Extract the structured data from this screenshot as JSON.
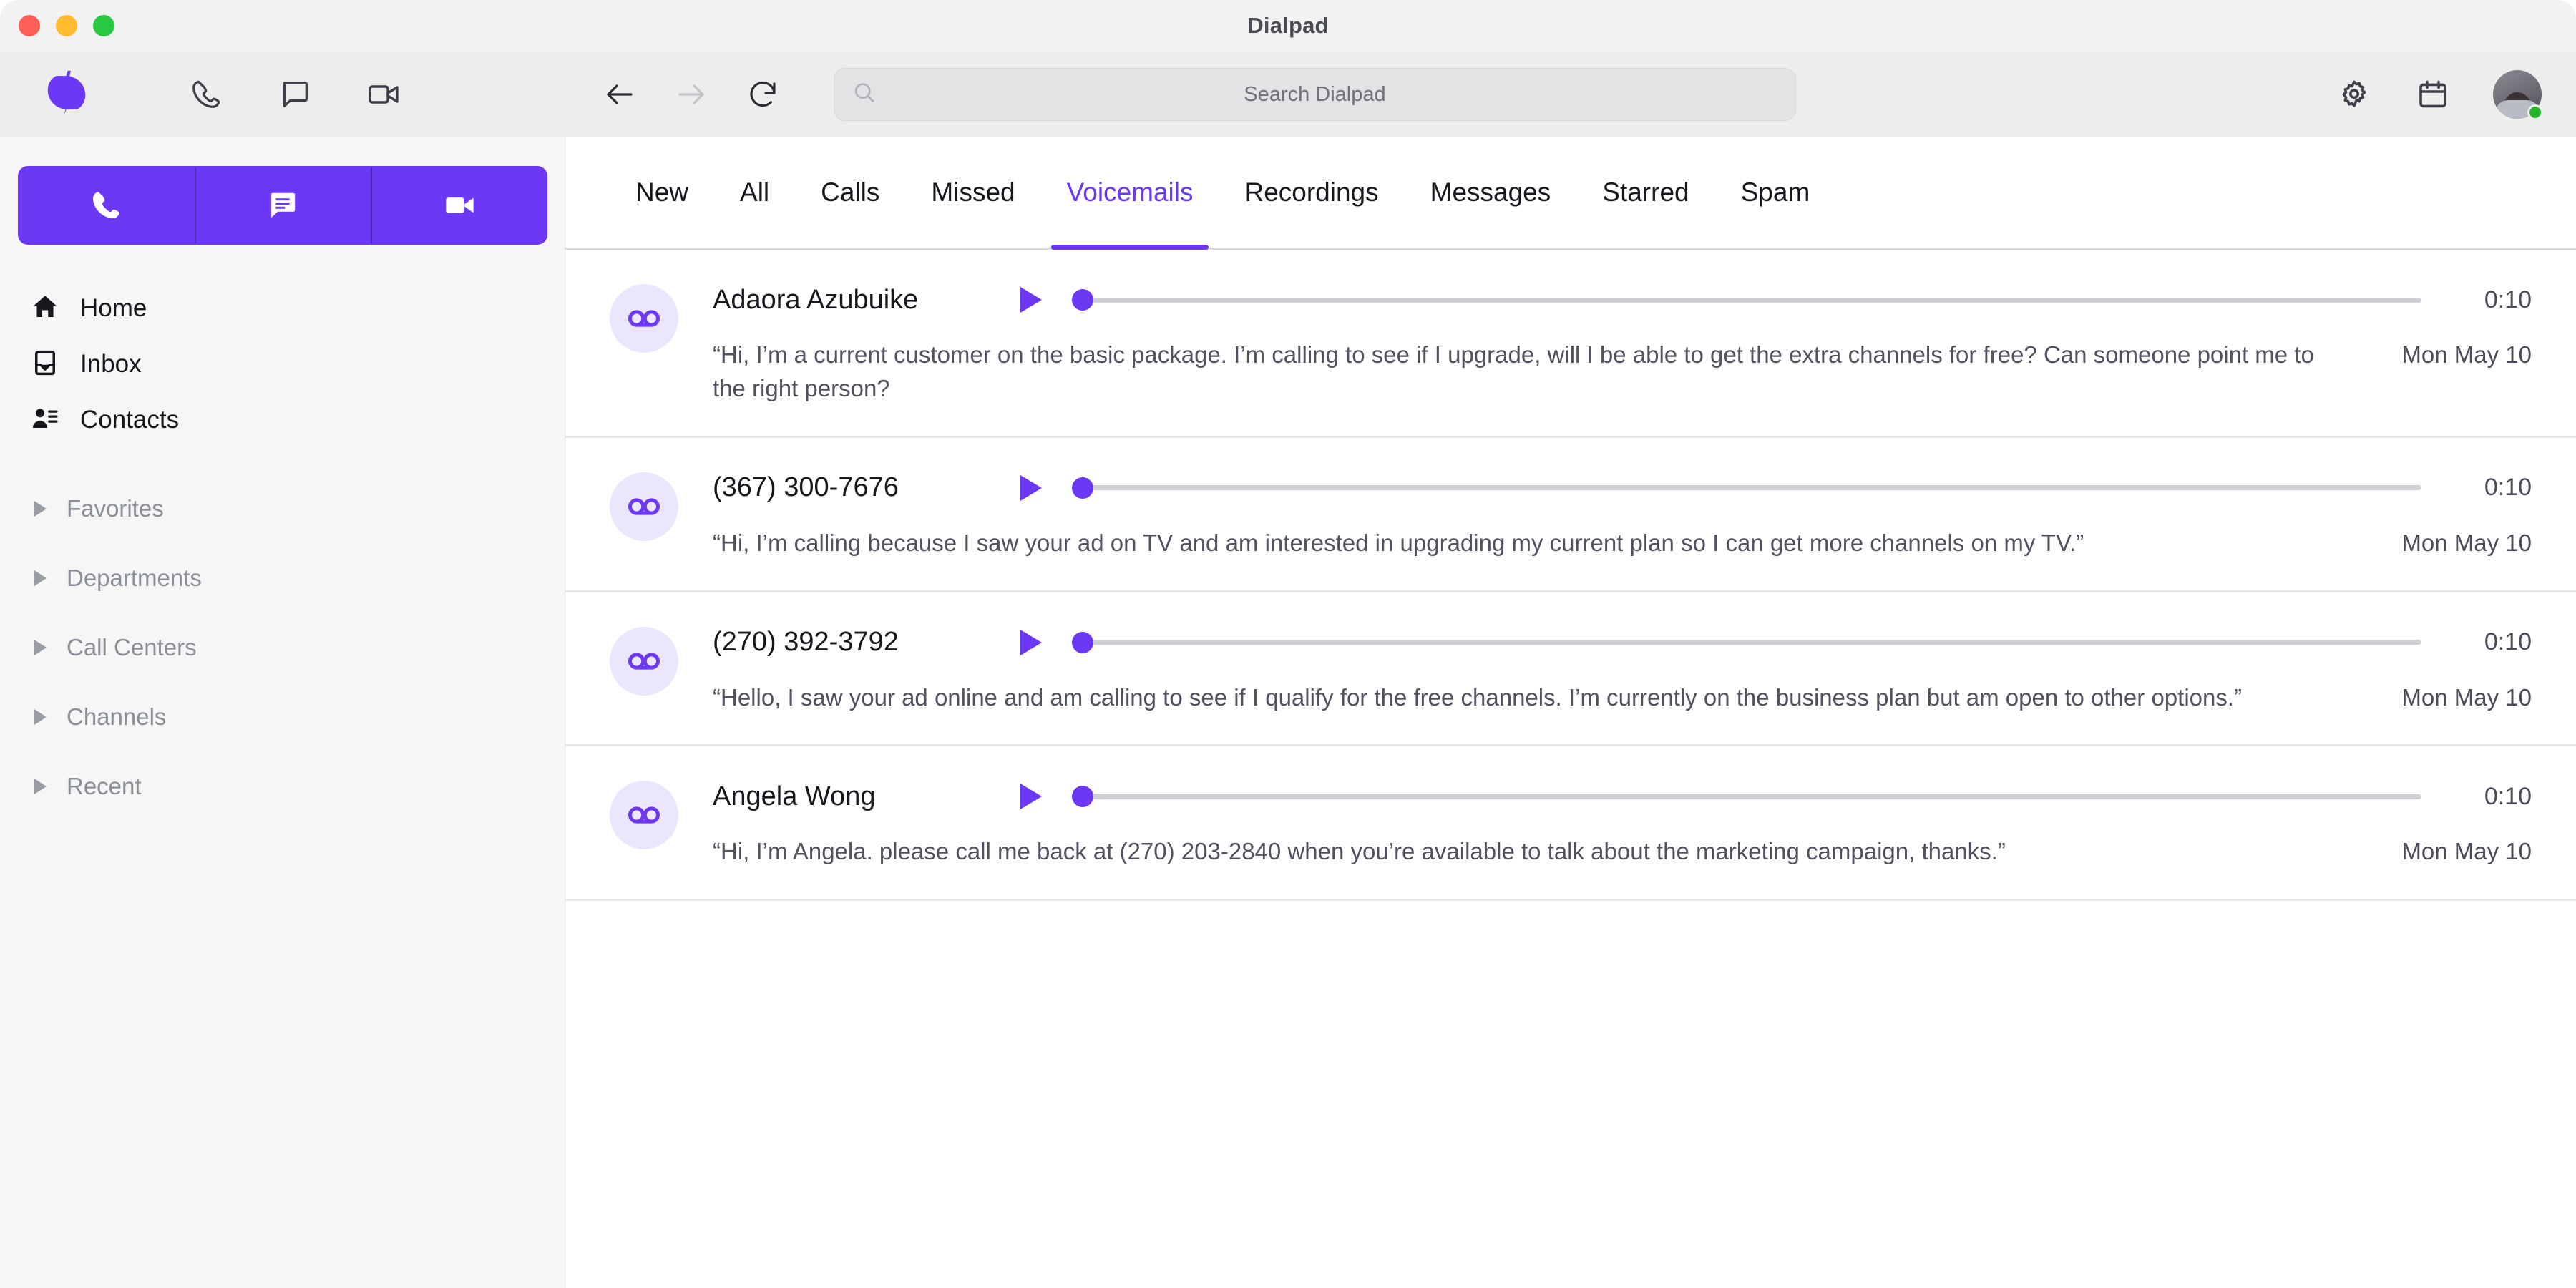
{
  "window": {
    "title": "Dialpad",
    "traffic_lights": [
      "close",
      "minimize",
      "zoom"
    ]
  },
  "colors": {
    "accent": "#6c38f5",
    "avatar_bg": "#ece5fe",
    "sidebar_bg": "#f6f6f7",
    "toolbar_bg": "#ededed",
    "divider": "#e8e8ec",
    "muted_text": "#8b8f98"
  },
  "toolbar": {
    "logo": "dialpad-logo-icon",
    "quick_actions": [
      {
        "name": "phone-icon",
        "label": "Call"
      },
      {
        "name": "message-icon",
        "label": "Message"
      },
      {
        "name": "video-icon",
        "label": "Video"
      }
    ],
    "nav": [
      {
        "name": "back-icon",
        "label": "Back",
        "enabled": true
      },
      {
        "name": "forward-icon",
        "label": "Forward",
        "enabled": false
      },
      {
        "name": "reload-icon",
        "label": "Reload",
        "enabled": true
      }
    ],
    "search": {
      "placeholder": "Search Dialpad",
      "value": "",
      "icon": "search-icon"
    },
    "right_actions": [
      {
        "name": "gear-icon",
        "label": "Settings"
      },
      {
        "name": "calendar-icon",
        "label": "Calendar"
      }
    ],
    "account": {
      "avatar": "user-avatar",
      "presence": "online"
    }
  },
  "sidebar": {
    "compose": [
      {
        "name": "new-call-button",
        "icon": "phone-icon",
        "label": "New call"
      },
      {
        "name": "new-message-button",
        "icon": "message-icon",
        "label": "New message"
      },
      {
        "name": "new-meeting-button",
        "icon": "video-icon",
        "label": "New meeting"
      }
    ],
    "nav_items": [
      {
        "label": "Home",
        "icon": "home-icon"
      },
      {
        "label": "Inbox",
        "icon": "inbox-icon"
      },
      {
        "label": "Contacts",
        "icon": "contacts-icon"
      }
    ],
    "sections": [
      {
        "label": "Favorites",
        "expanded": false
      },
      {
        "label": "Departments",
        "expanded": false
      },
      {
        "label": "Call Centers",
        "expanded": false
      },
      {
        "label": "Channels",
        "expanded": false
      },
      {
        "label": "Recent",
        "expanded": false
      }
    ]
  },
  "main": {
    "tabs": [
      {
        "label": "New",
        "active": false
      },
      {
        "label": "All",
        "active": false
      },
      {
        "label": "Calls",
        "active": false
      },
      {
        "label": "Missed",
        "active": false
      },
      {
        "label": "Voicemails",
        "active": true
      },
      {
        "label": "Recordings",
        "active": false
      },
      {
        "label": "Messages",
        "active": false
      },
      {
        "label": "Starred",
        "active": false
      },
      {
        "label": "Spam",
        "active": false
      }
    ],
    "voicemails": [
      {
        "name": "Adaora Azubuike",
        "duration": "0:10",
        "date": "Mon May 10",
        "transcript": "“Hi, I’m a current customer on the basic package. I’m calling to see if I upgrade, will I be able to get the extra channels for free? Can someone point me to the right person?",
        "avatar_icon": "voicemail-icon",
        "play_icon": "play-icon",
        "progress": 0
      },
      {
        "name": "(367) 300-7676",
        "duration": "0:10",
        "date": "Mon May 10",
        "transcript": "“Hi, I’m calling because I saw your ad on TV and am interested in upgrading my current plan so I can get more channels on my TV.”",
        "avatar_icon": "voicemail-icon",
        "play_icon": "play-icon",
        "progress": 0
      },
      {
        "name": "(270) 392-3792",
        "duration": "0:10",
        "date": "Mon May 10",
        "transcript": "“Hello, I saw your ad online and am calling to see if I qualify for the free channels. I’m currently on the business plan but am open to other options.”",
        "avatar_icon": "voicemail-icon",
        "play_icon": "play-icon",
        "progress": 0
      },
      {
        "name": "Angela Wong",
        "duration": "0:10",
        "date": "Mon May 10",
        "transcript": "“Hi, I’m Angela. please call me back at (270) 203-2840 when you’re available to talk about the marketing campaign, thanks.”",
        "avatar_icon": "voicemail-icon",
        "play_icon": "play-icon",
        "progress": 0
      }
    ]
  }
}
